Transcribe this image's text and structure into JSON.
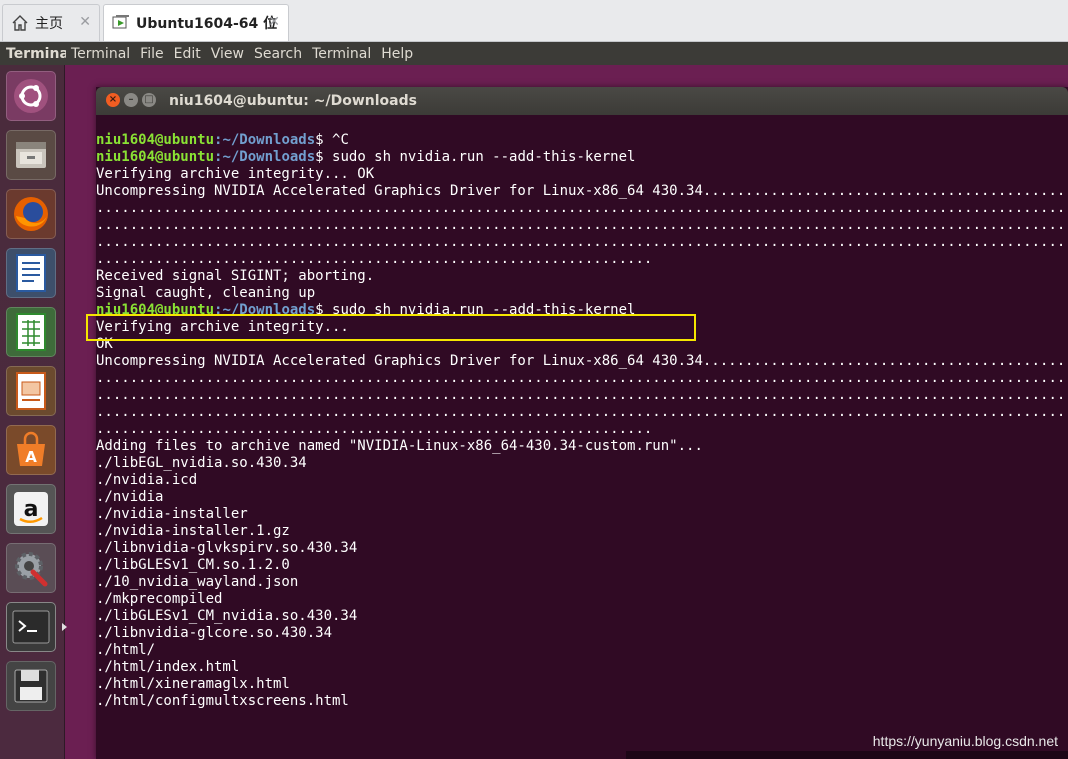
{
  "host_tabs": [
    {
      "label": "主页",
      "icon": "home-icon"
    },
    {
      "label": "Ubuntu1604-64 位",
      "icon": "vm-icon"
    }
  ],
  "menubar": {
    "app_name": "Terminal",
    "items": [
      "Terminal",
      "File",
      "Edit",
      "View",
      "Search",
      "Terminal",
      "Help"
    ]
  },
  "launcher": {
    "items": [
      "ubuntu-dash-icon",
      "files-icon",
      "firefox-icon",
      "writer-icon",
      "calc-icon",
      "impress-icon",
      "software-center-icon",
      "amazon-icon",
      "system-settings-icon",
      "terminal-icon",
      "save-disk-icon"
    ]
  },
  "terminal": {
    "title": "niu1604@ubuntu: ~/Downloads",
    "prompt_user": "niu1604@ubuntu",
    "prompt_path": ":~/Downloads",
    "lines": [
      {
        "type": "prompt",
        "cmd": "$ ^C"
      },
      {
        "type": "prompt",
        "cmd": "$ sudo sh nvidia.run --add-this-kernel"
      },
      {
        "type": "text",
        "text": "Verifying archive integrity... OK"
      },
      {
        "type": "text",
        "text": "Uncompressing NVIDIA Accelerated Graphics Driver for Linux-x86_64 430.34................................................"
      },
      {
        "type": "text",
        "text": "................................................................................................................................"
      },
      {
        "type": "text",
        "text": "................................................................................................................................"
      },
      {
        "type": "text",
        "text": "................................................................................................................................"
      },
      {
        "type": "text",
        "text": ".................................................................."
      },
      {
        "type": "text",
        "text": "Received signal SIGINT; aborting."
      },
      {
        "type": "text",
        "text": "Signal caught, cleaning up"
      },
      {
        "type": "prompt",
        "cmd": "$ sudo sh nvidia.run --add-this-kernel"
      },
      {
        "type": "text",
        "text": "Verifying archive integrity..."
      },
      {
        "type": "text",
        "text": "OK"
      },
      {
        "type": "text",
        "text": "Uncompressing NVIDIA Accelerated Graphics Driver for Linux-x86_64 430.34................................................"
      },
      {
        "type": "text",
        "text": "................................................................................................................................"
      },
      {
        "type": "text",
        "text": "................................................................................................................................"
      },
      {
        "type": "text",
        "text": "................................................................................................................................"
      },
      {
        "type": "text",
        "text": ".................................................................."
      },
      {
        "type": "text",
        "text": "Adding files to archive named \"NVIDIA-Linux-x86_64-430.34-custom.run\"..."
      },
      {
        "type": "text",
        "text": "./libEGL_nvidia.so.430.34"
      },
      {
        "type": "text",
        "text": "./nvidia.icd"
      },
      {
        "type": "text",
        "text": "./nvidia"
      },
      {
        "type": "text",
        "text": "./nvidia-installer"
      },
      {
        "type": "text",
        "text": "./nvidia-installer.1.gz"
      },
      {
        "type": "text",
        "text": "./libnvidia-glvkspirv.so.430.34"
      },
      {
        "type": "text",
        "text": "./libGLESv1_CM.so.1.2.0"
      },
      {
        "type": "text",
        "text": "./10_nvidia_wayland.json"
      },
      {
        "type": "text",
        "text": "./mkprecompiled"
      },
      {
        "type": "text",
        "text": "./libGLESv1_CM_nvidia.so.430.34"
      },
      {
        "type": "text",
        "text": "./libnvidia-glcore.so.430.34"
      },
      {
        "type": "text",
        "text": "./html/"
      },
      {
        "type": "text",
        "text": "./html/index.html"
      },
      {
        "type": "text",
        "text": "./html/xineramaglx.html"
      },
      {
        "type": "text",
        "text": "./html/configmultxscreens.html"
      }
    ]
  },
  "watermark": "https://yunyaniu.blog.csdn.net",
  "colors": {
    "terminal_bg": "#300a24",
    "prompt_user": "#8ae234",
    "prompt_path": "#729fcf",
    "highlight_box": "#f5e600"
  }
}
